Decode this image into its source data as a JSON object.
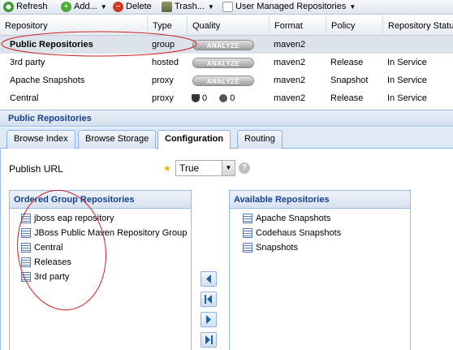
{
  "toolbar": {
    "refresh": "Refresh",
    "add": "Add...",
    "delete": "Delete",
    "trash": "Trash...",
    "filter": "User Managed Repositories"
  },
  "grid": {
    "columns": [
      "Repository",
      "Type",
      "Quality",
      "Format",
      "Policy",
      "Repository Status"
    ],
    "analyze_label": "ANALYZE",
    "rows": [
      {
        "name": "Public Repositories",
        "type": "group",
        "format": "maven2",
        "policy": "",
        "status": ""
      },
      {
        "name": "3rd party",
        "type": "hosted",
        "format": "maven2",
        "policy": "Release",
        "status": "In Service"
      },
      {
        "name": "Apache Snapshots",
        "type": "proxy",
        "format": "maven2",
        "policy": "Snapshot",
        "status": "In Service"
      },
      {
        "name": "Central",
        "type": "proxy",
        "format": "maven2",
        "policy": "Release",
        "status": "In Service",
        "quality_a": "0",
        "quality_b": "0"
      }
    ]
  },
  "panel": {
    "title": "Public Repositories",
    "tabs": [
      "Browse Index",
      "Browse Storage",
      "Configuration",
      "Routing"
    ],
    "active_tab": "Configuration"
  },
  "config": {
    "publish_url_label": "Publish URL",
    "publish_url_value": "True",
    "help": "?"
  },
  "ordered_group": {
    "title": "Ordered Group Repositories",
    "items": [
      "jboss eap repository",
      "JBoss Public Maven Repository Group",
      "Central",
      "Releases",
      "3rd party"
    ]
  },
  "available": {
    "title": "Available Repositories",
    "items": [
      "Apache Snapshots",
      "Codehaus Snapshots",
      "Snapshots"
    ]
  },
  "colors": {
    "annotation": "#cc1f1f",
    "selection": "#dde3ea",
    "panel_header_text": "#15428b"
  },
  "icons": [
    "refresh-icon",
    "add-icon",
    "delete-icon",
    "trash-icon",
    "repository-icon",
    "move-left-icon",
    "move-first-icon",
    "move-right-icon",
    "move-last-icon"
  ]
}
